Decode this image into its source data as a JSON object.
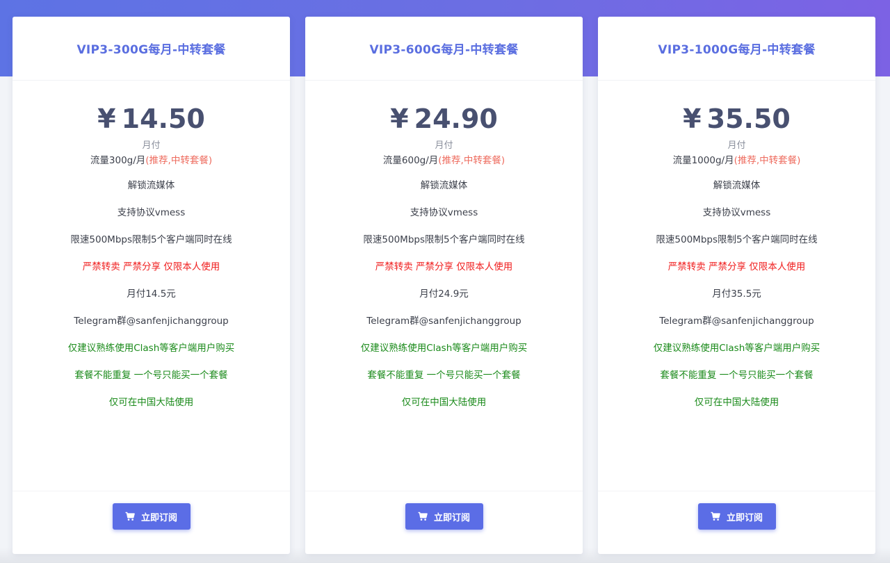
{
  "colors": {
    "hero_gradient_start": "#5d73e4",
    "hero_gradient_end": "#7c62e4",
    "title": "#5a6ee0",
    "price": "#485070",
    "note": "#ee6b5e",
    "warning": "#f01f1f",
    "recommendation": "#1a8a1a",
    "button": "#5b6de6"
  },
  "plans": [
    {
      "title": "VIP3-300G每月-中转套餐",
      "currency": "¥",
      "price": "14.50",
      "cycle": "月付",
      "traffic": "流量300g/月",
      "traffic_note": "(推荐,中转套餐)",
      "features": [
        "解锁流媒体",
        "支持协议vmess",
        "限速500Mbps限制5个客户端同时在线",
        "严禁转卖 严禁分享 仅限本人使用",
        "月付14.5元",
        "Telegram群@sanfenjichanggroup",
        "仅建议熟练使用Clash等客户端用户购买",
        "套餐不能重复 一个号只能买一个套餐",
        "仅可在中国大陆使用"
      ],
      "button_icon": "cart-icon",
      "button_label": "立即订阅"
    },
    {
      "title": "VIP3-600G每月-中转套餐",
      "currency": "¥",
      "price": "24.90",
      "cycle": "月付",
      "traffic": "流量600g/月",
      "traffic_note": "(推荐,中转套餐)",
      "features": [
        "解锁流媒体",
        "支持协议vmess",
        "限速500Mbps限制5个客户端同时在线",
        "严禁转卖 严禁分享 仅限本人使用",
        "月付24.9元",
        "Telegram群@sanfenjichanggroup",
        "仅建议熟练使用Clash等客户端用户购买",
        "套餐不能重复 一个号只能买一个套餐",
        "仅可在中国大陆使用"
      ],
      "button_icon": "cart-icon",
      "button_label": "立即订阅"
    },
    {
      "title": "VIP3-1000G每月-中转套餐",
      "currency": "¥",
      "price": "35.50",
      "cycle": "月付",
      "traffic": "流量1000g/月",
      "traffic_note": "(推荐,中转套餐)",
      "features": [
        "解锁流媒体",
        "支持协议vmess",
        "限速500Mbps限制5个客户端同时在线",
        "严禁转卖 严禁分享 仅限本人使用",
        "月付35.5元",
        "Telegram群@sanfenjichanggroup",
        "仅建议熟练使用Clash等客户端用户购买",
        "套餐不能重复 一个号只能买一个套餐",
        "仅可在中国大陆使用"
      ],
      "button_icon": "cart-icon",
      "button_label": "立即订阅"
    }
  ]
}
